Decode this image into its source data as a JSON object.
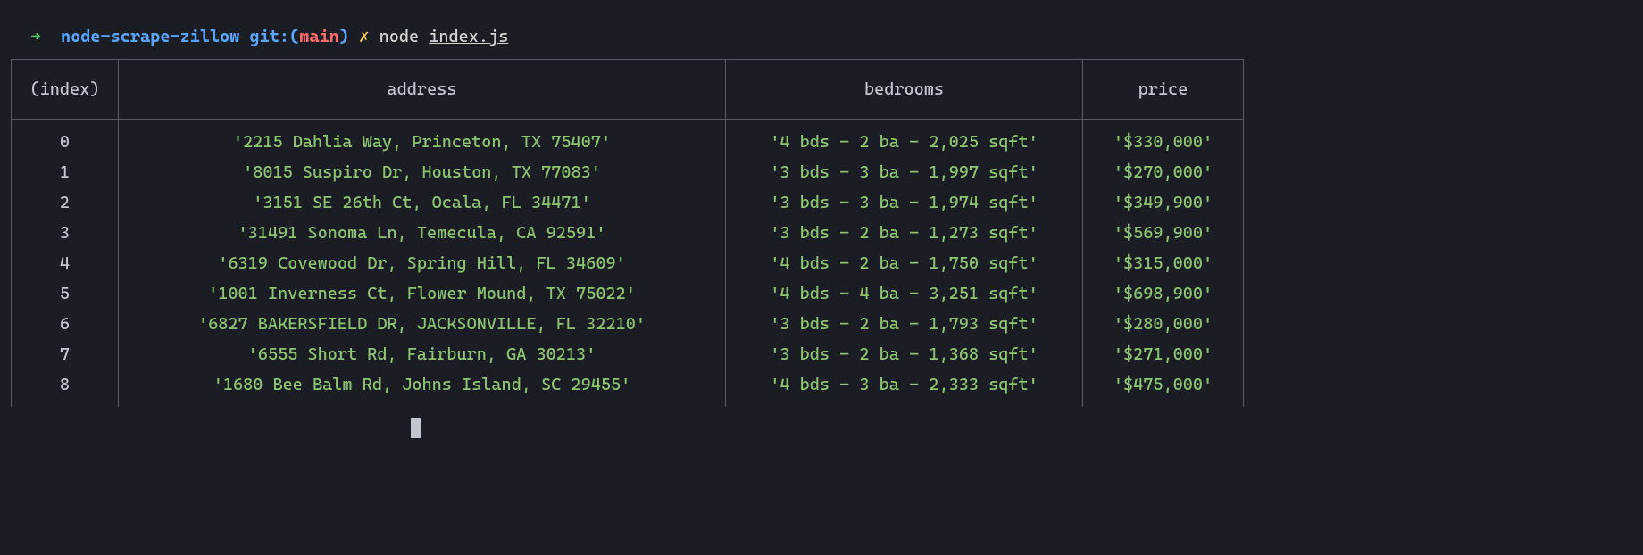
{
  "prompt": {
    "arrow": "➜",
    "dir": "node-scrape-zillow",
    "git_label": "git:",
    "paren_open": "(",
    "branch": "main",
    "paren_close": ")",
    "dirty": "✗",
    "command": "node",
    "file": "index.js"
  },
  "table": {
    "headers": {
      "index": "(index)",
      "address": "address",
      "bedrooms": "bedrooms",
      "price": "price"
    },
    "rows": [
      {
        "index": "0",
        "address": "'2215 Dahlia Way, Princeton, TX 75407'",
        "bedrooms": "'4 bds - 2 ba - 2,025 sqft'",
        "price": "'$330,000'"
      },
      {
        "index": "1",
        "address": "'8015 Suspiro Dr, Houston, TX 77083'",
        "bedrooms": "'3 bds - 3 ba - 1,997 sqft'",
        "price": "'$270,000'"
      },
      {
        "index": "2",
        "address": "'3151 SE 26th Ct, Ocala, FL 34471'",
        "bedrooms": "'3 bds - 3 ba - 1,974 sqft'",
        "price": "'$349,900'"
      },
      {
        "index": "3",
        "address": "'31491 Sonoma Ln, Temecula, CA 92591'",
        "bedrooms": "'3 bds - 2 ba - 1,273 sqft'",
        "price": "'$569,900'"
      },
      {
        "index": "4",
        "address": "'6319 Covewood Dr, Spring Hill, FL 34609'",
        "bedrooms": "'4 bds - 2 ba - 1,750 sqft'",
        "price": "'$315,000'"
      },
      {
        "index": "5",
        "address": "'1001 Inverness Ct, Flower Mound, TX 75022'",
        "bedrooms": "'4 bds - 4 ba - 3,251 sqft'",
        "price": "'$698,900'"
      },
      {
        "index": "6",
        "address": "'6827 BAKERSFIELD DR, JACKSONVILLE, FL 32210'",
        "bedrooms": "'3 bds - 2 ba - 1,793 sqft'",
        "price": "'$280,000'"
      },
      {
        "index": "7",
        "address": "'6555 Short Rd, Fairburn, GA 30213'",
        "bedrooms": "'3 bds - 2 ba - 1,368 sqft'",
        "price": "'$271,000'"
      },
      {
        "index": "8",
        "address": "'1680 Bee Balm Rd, Johns Island, SC 29455'",
        "bedrooms": "'4 bds - 3 ba - 2,333 sqft'",
        "price": "'$475,000'"
      }
    ]
  }
}
